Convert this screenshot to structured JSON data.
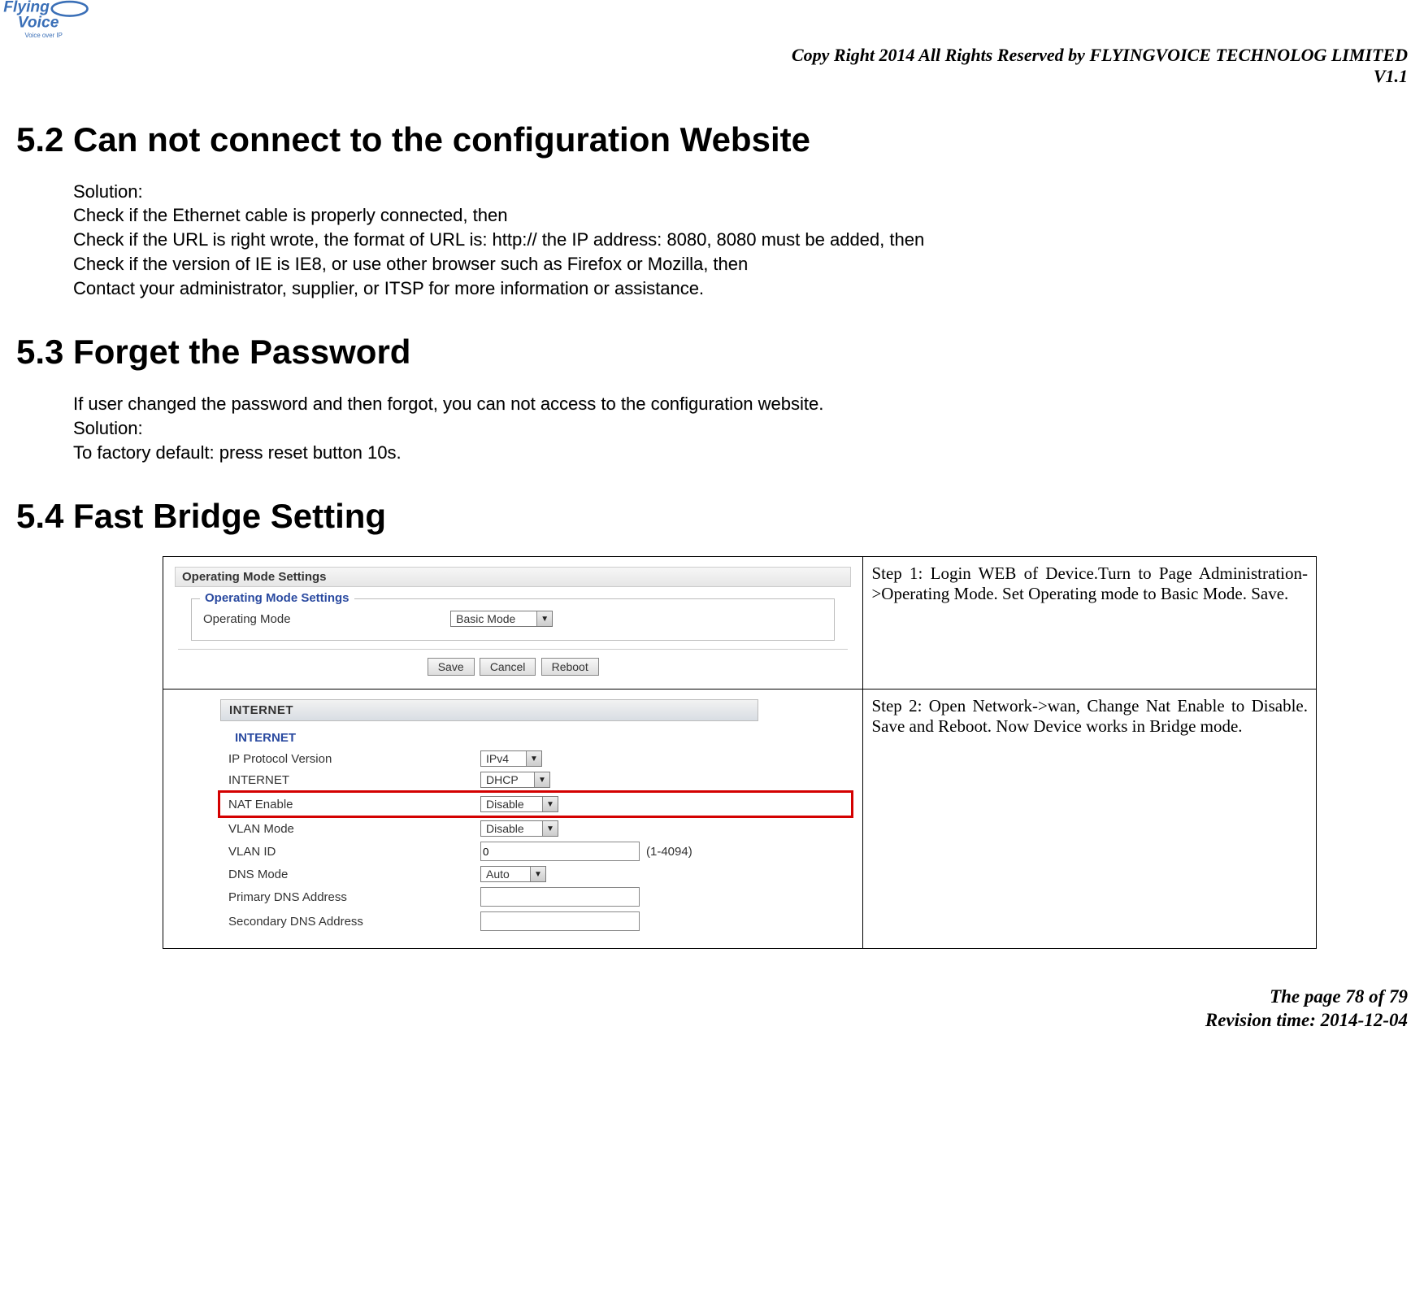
{
  "header": {
    "copyright": "Copy Right 2014 All Rights Reserved by FLYINGVOICE TECHNOLOG LIMITED",
    "version": "V1.1",
    "logo_text_top": "Flying",
    "logo_text_bottom": "Voice",
    "logo_tagline": "Voice over IP"
  },
  "sections": {
    "s52": {
      "title": "5.2  Can not connect to the configuration Website",
      "lines": [
        "Solution:",
        "Check if the Ethernet cable is properly connected, then",
        "Check if the URL is right wrote, the format of URL is: http:// the IP address: 8080, 8080 must be added, then",
        "Check if the version of IE is IE8, or use other browser such as Firefox or Mozilla, then",
        "Contact your administrator, supplier, or ITSP for more information or assistance."
      ]
    },
    "s53": {
      "title": "5.3  Forget the Password",
      "lines": [
        "If user changed the password and then forgot, you can not access to the configuration website.",
        "Solution:",
        "To factory default: press reset button 10s."
      ]
    },
    "s54": {
      "title": "5.4  Fast Bridge Setting"
    }
  },
  "step1": {
    "panel_title": "Operating Mode Settings",
    "legend": "Operating Mode Settings",
    "label": "Operating Mode",
    "value": "Basic Mode",
    "buttons": {
      "save": "Save",
      "cancel": "Cancel",
      "reboot": "Reboot"
    },
    "desc": "Step 1: Login WEB of Device.Turn to Page Administration->Operating Mode. Set Operating mode to Basic Mode. Save."
  },
  "step2": {
    "header": "INTERNET",
    "subheader": "INTERNET",
    "rows": {
      "ipproto": {
        "label": "IP Protocol Version",
        "value": "IPv4"
      },
      "internet": {
        "label": "INTERNET",
        "value": "DHCP"
      },
      "nat": {
        "label": "NAT Enable",
        "value": "Disable"
      },
      "vlanmode": {
        "label": "VLAN Mode",
        "value": "Disable"
      },
      "vlanid": {
        "label": "VLAN ID",
        "value": "0",
        "hint": "(1-4094)"
      },
      "dnsmode": {
        "label": "DNS Mode",
        "value": "Auto"
      },
      "pdns": {
        "label": "Primary DNS Address",
        "value": ""
      },
      "sdns": {
        "label": "Secondary DNS Address",
        "value": ""
      }
    },
    "desc": "Step 2: Open Network->wan, Change Nat Enable to Disable. Save and Reboot. Now Device works in Bridge mode."
  },
  "footer": {
    "page": "The page 78 of 79",
    "rev": "Revision time: 2014-12-04"
  }
}
